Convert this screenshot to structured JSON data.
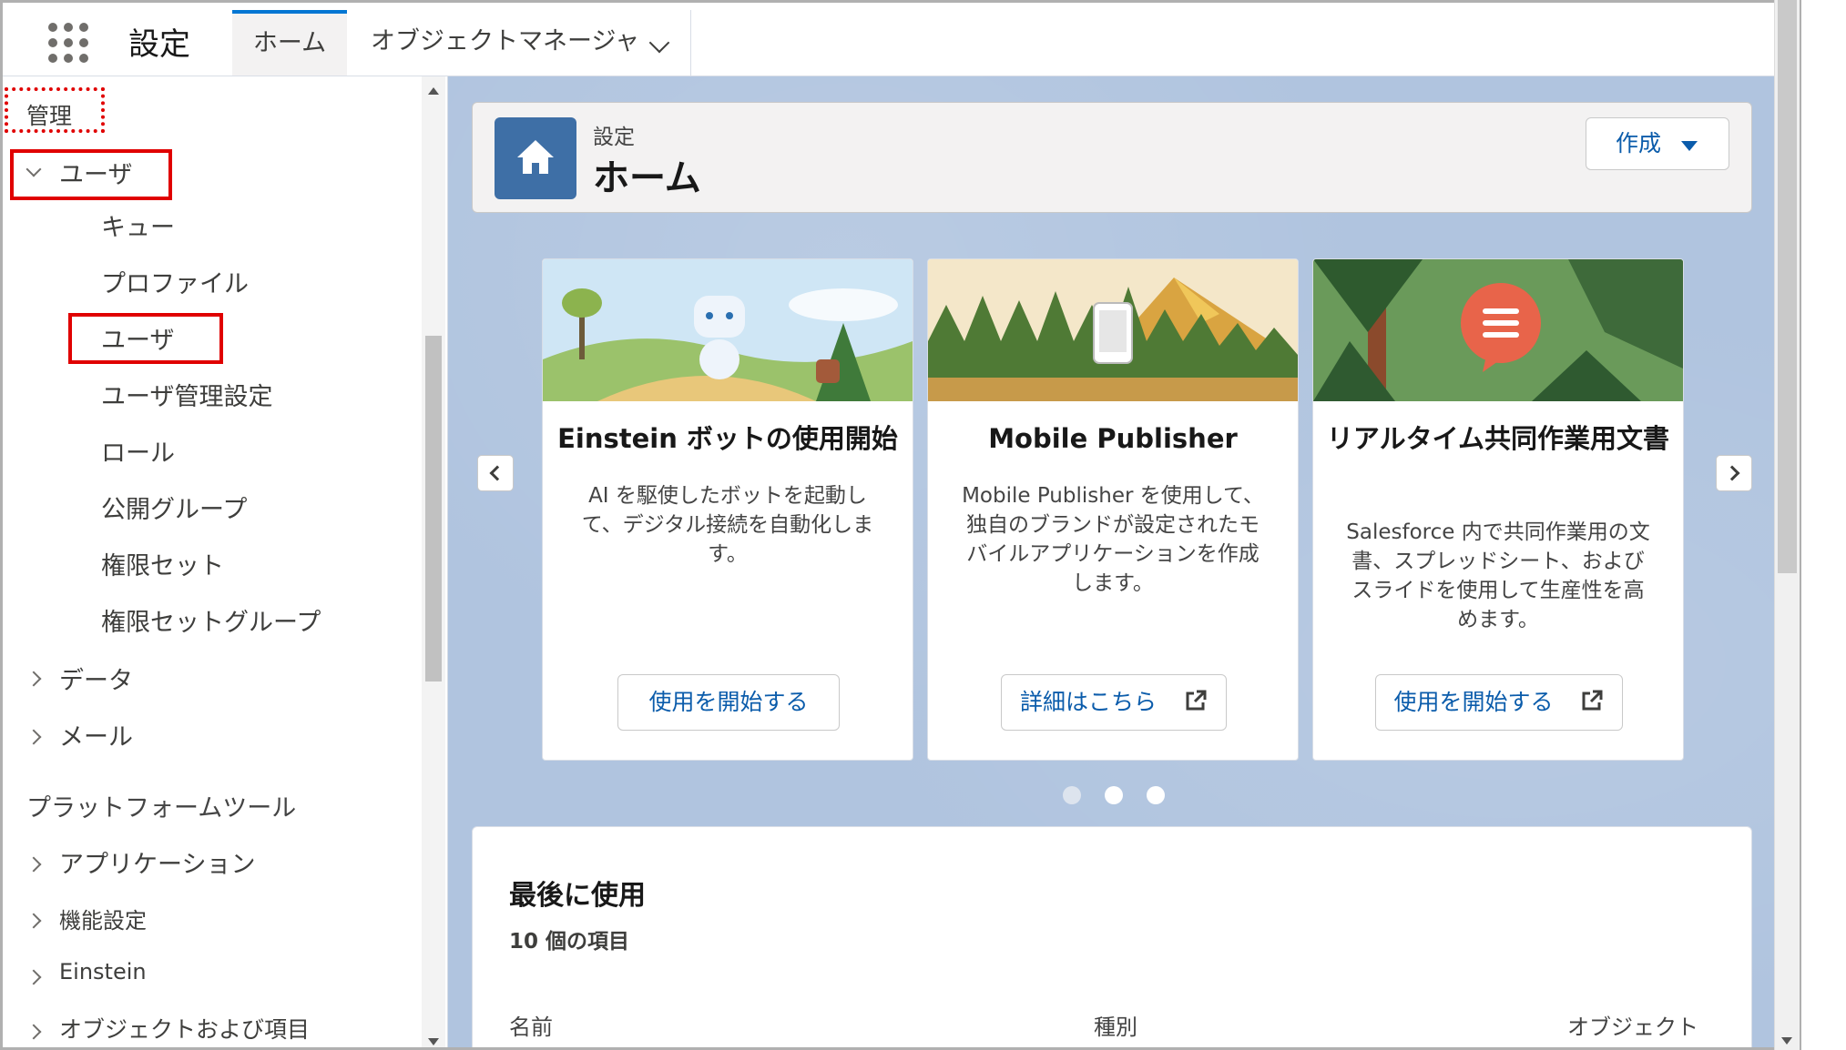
{
  "topbar": {
    "app_name": "設定",
    "tabs": [
      {
        "label": "ホーム",
        "active": true
      },
      {
        "label": "オブジェクトマネージャ",
        "active": false
      }
    ]
  },
  "sidebar": {
    "section_admin": "管理",
    "users_group": "ユーザ",
    "user_items": [
      "キュー",
      "プロファイル",
      "ユーザ",
      "ユーザ管理設定",
      "ロール",
      "公開グループ",
      "権限セット",
      "権限セットグループ"
    ],
    "data_group": "データ",
    "mail_group": "メール",
    "section_platform": "プラットフォームツール",
    "platform_items": [
      "アプリケーション",
      "機能設定",
      "Einstein",
      "オブジェクトおよび項目"
    ]
  },
  "header": {
    "subtitle": "設定",
    "title": "ホーム",
    "create_label": "作成"
  },
  "cards": [
    {
      "title": "Einstein ボットの使用開始",
      "desc": "AI を駆使したボットを起動して、デジタル接続を自動化します。",
      "button": "使用を開始する"
    },
    {
      "title": "Mobile Publisher",
      "desc": "Mobile Publisher を使用して、独自のブランドが設定されたモバイルアプリケーションを作成します。",
      "button": "詳細はこちら"
    },
    {
      "title": "リアルタイム共同作業用文書",
      "desc": "Salesforce 内で共同作業用の文書、スプレッドシート、およびスライドを使用して生産性を高めます。",
      "button": "使用を開始する"
    }
  ],
  "carousel": {
    "active_index": 0,
    "count": 3
  },
  "recent": {
    "title": "最後に使用",
    "count": "10 個の項目",
    "columns": [
      "名前",
      "種別",
      "オブジェクト"
    ]
  },
  "colors": {
    "brand": "#0176d3",
    "link": "#0b5cab",
    "highlight": "#e00000",
    "home_icon": "#3e6fa6"
  }
}
